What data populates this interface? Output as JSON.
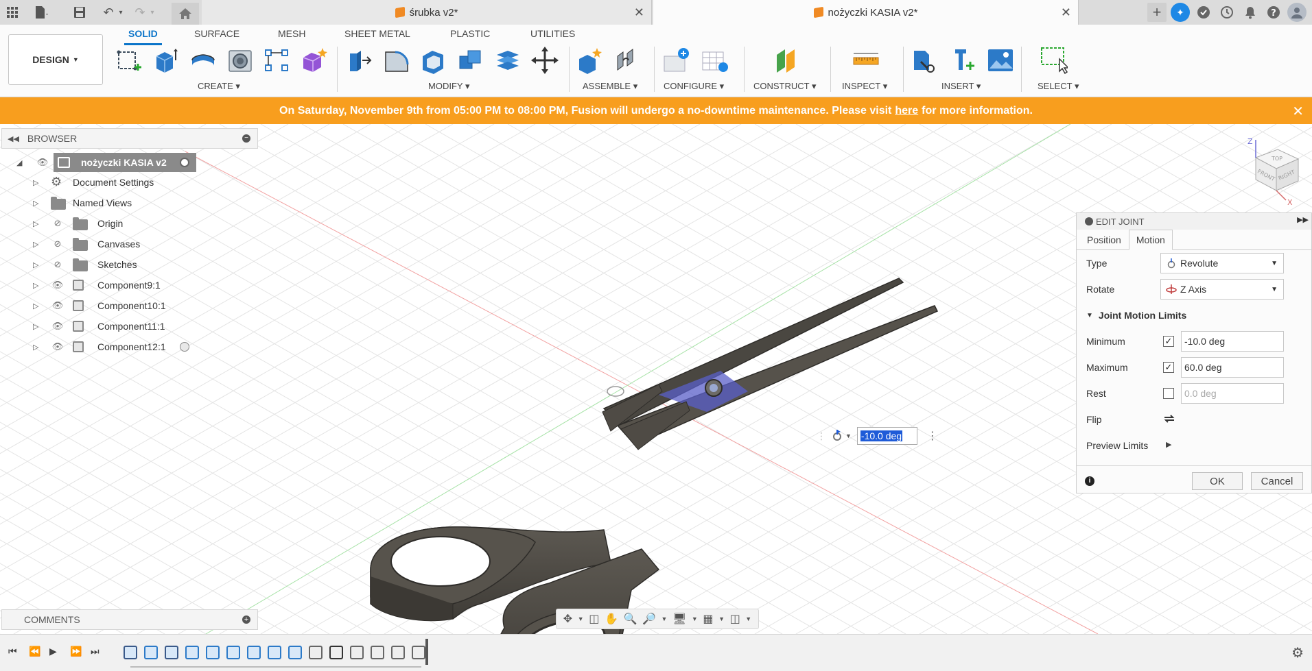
{
  "tabs": [
    {
      "label": "śrubka v2*",
      "active": false
    },
    {
      "label": "nożyczki KASIA v2*",
      "active": true
    }
  ],
  "workspace": "DESIGN",
  "ribbon_tabs": [
    "SOLID",
    "SURFACE",
    "MESH",
    "SHEET METAL",
    "PLASTIC",
    "UTILITIES"
  ],
  "ribbon_groups": [
    "CREATE",
    "MODIFY",
    "ASSEMBLE",
    "CONFIGURE",
    "CONSTRUCT",
    "INSPECT",
    "INSERT",
    "SELECT"
  ],
  "banner": {
    "text_before": "On Saturday, November 9th from 05:00 PM to 08:00 PM, Fusion will undergo a no-downtime maintenance. Please visit",
    "link": "here",
    "text_after": "for more information."
  },
  "browser": {
    "title": "BROWSER",
    "root": "nożyczki KASIA v2",
    "items": [
      {
        "label": "Document Settings",
        "icon": "gear-icon"
      },
      {
        "label": "Named Views",
        "icon": "folder-icon"
      },
      {
        "label": "Origin",
        "icon": "folder-icon"
      },
      {
        "label": "Canvases",
        "icon": "folder-icon"
      },
      {
        "label": "Sketches",
        "icon": "folder-icon"
      },
      {
        "label": "Component9:1",
        "icon": "component-icon"
      },
      {
        "label": "Component10:1",
        "icon": "component-icon"
      },
      {
        "label": "Component11:1",
        "icon": "component-icon"
      },
      {
        "label": "Component12:1",
        "icon": "component-icon"
      }
    ]
  },
  "comments": "COMMENTS",
  "viewcube": {
    "top": "TOP",
    "front": "FRONT",
    "right": "RIGHT",
    "z": "Z",
    "x": "X"
  },
  "edit_joint": {
    "title": "EDIT JOINT",
    "tabs": [
      "Position",
      "Motion"
    ],
    "type_label": "Type",
    "type_value": "Revolute",
    "rotate_label": "Rotate",
    "rotate_value": "Z Axis",
    "section": "Joint Motion Limits",
    "minimum_label": "Minimum",
    "minimum_value": "-10.0 deg",
    "maximum_label": "Maximum",
    "maximum_value": "60.0 deg",
    "rest_label": "Rest",
    "rest_value": "0.0 deg",
    "flip_label": "Flip",
    "preview_label": "Preview Limits",
    "ok": "OK",
    "cancel": "Cancel"
  },
  "joint_value": "-10.0 deg",
  "colors": {
    "accent": "#0a74c9",
    "banner": "#f89e1e",
    "model": "#4f4b45"
  }
}
